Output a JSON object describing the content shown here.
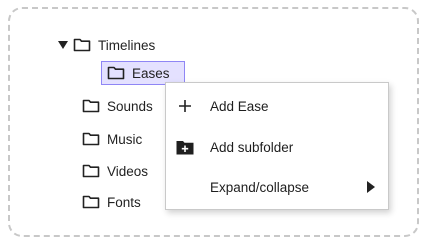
{
  "tree": {
    "items": [
      {
        "label": "Timelines",
        "expanded": true,
        "icon": "folder-icon"
      },
      {
        "label": "Eases",
        "selected": true,
        "icon": "folder-icon"
      },
      {
        "label": "Sounds",
        "icon": "folder-icon"
      },
      {
        "label": "Music",
        "icon": "folder-icon"
      },
      {
        "label": "Videos",
        "icon": "folder-icon"
      },
      {
        "label": "Fonts",
        "icon": "folder-icon"
      }
    ]
  },
  "context_menu": {
    "items": [
      {
        "label": "Add Ease",
        "icon": "plus-icon"
      },
      {
        "label": "Add subfolder",
        "icon": "folder-add-icon"
      },
      {
        "label": "Expand/collapse",
        "icon": "submenu-arrow-icon"
      }
    ]
  },
  "colors": {
    "selection_bg": "#e4e1ff",
    "selection_border": "#8f86f5",
    "frame_border": "#c8c8c8"
  }
}
